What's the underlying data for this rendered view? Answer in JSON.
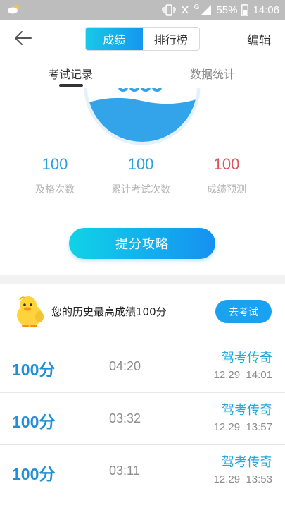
{
  "status_bar": {
    "weather_icon": "cloud-sun-icon",
    "battery": "55%",
    "time": "14:06",
    "network_label": "G"
  },
  "header": {
    "back_icon": "arrow-left-icon",
    "tabs": [
      {
        "label": "成绩",
        "active": true
      },
      {
        "label": "排行榜",
        "active": false
      }
    ],
    "edit_label": "编辑",
    "accent": "#1696f0"
  },
  "subtabs": [
    {
      "label": "考试记录",
      "active": true
    },
    {
      "label": "数据统计",
      "active": false
    }
  ],
  "stats": [
    {
      "value": "100",
      "label": "及格次数",
      "color": "#2aa0d8"
    },
    {
      "value": "100",
      "label": "累计考试次数",
      "color": "#2aa0d8"
    },
    {
      "value": "100",
      "label": "成绩预测",
      "color": "#e0525a"
    }
  ],
  "tips_button": "提分攻略",
  "best": {
    "text": "您的历史最高成绩100分",
    "button": "去考试",
    "avatar_icon": "duck-icon"
  },
  "records": [
    {
      "score": "100",
      "unit": "分",
      "duration": "04:20",
      "title": "驾考传奇",
      "date": "12.29",
      "time": "14:01"
    },
    {
      "score": "100",
      "unit": "分",
      "duration": "03:32",
      "title": "驾考传奇",
      "date": "12.29",
      "time": "13:57"
    },
    {
      "score": "100",
      "unit": "分",
      "duration": "03:11",
      "title": "驾考传奇",
      "date": "12.29",
      "time": "13:53"
    }
  ]
}
